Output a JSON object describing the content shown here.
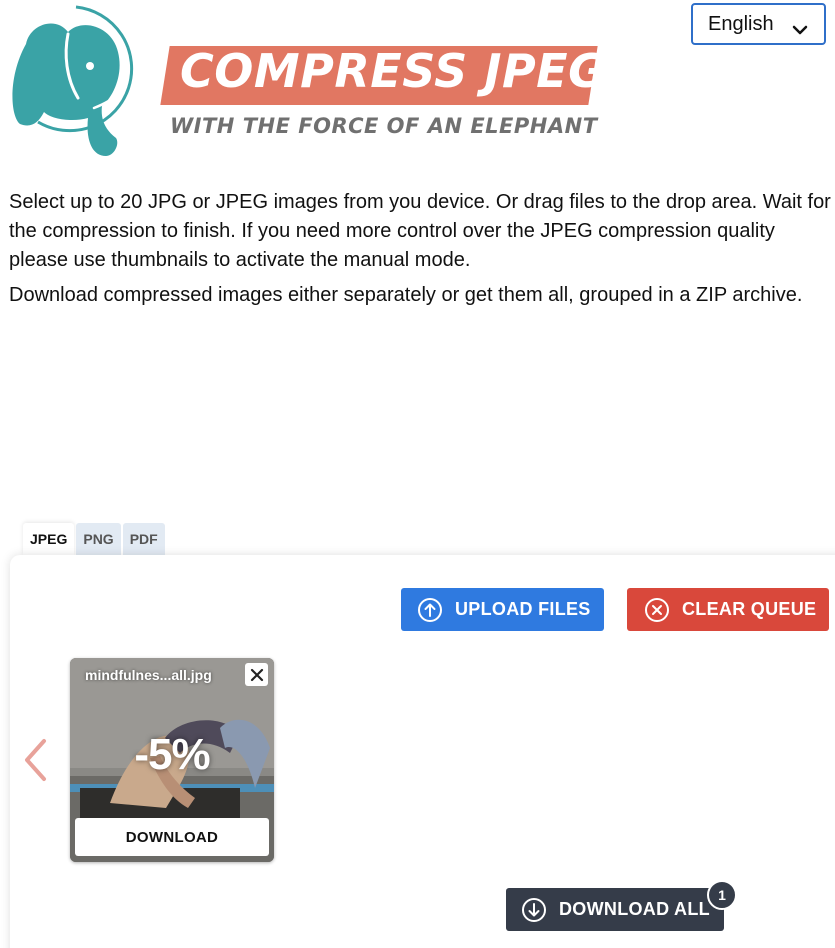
{
  "language": {
    "selected": "English"
  },
  "logo": {
    "title": "COMPRESS JPEG",
    "subtitle": "WITH THE FORCE OF AN ELEPHANT",
    "icon": "elephant-logo-icon",
    "colors": {
      "elephant": "#3aa3a6",
      "banner": "#e17762",
      "subtitle": "#707070"
    }
  },
  "intro": {
    "p1": "Select up to 20 JPG or JPEG images from you device. Or drag files to the drop area. Wait for the compression to finish. If you need more control over the JPEG compression quality please use thumbnails to activate the manual mode.",
    "p2": "Download compressed images either separately or get them all, grouped in a ZIP archive."
  },
  "tabs": [
    {
      "label": "JPEG",
      "active": true
    },
    {
      "label": "PNG",
      "active": false
    },
    {
      "label": "PDF",
      "active": false
    }
  ],
  "toolbar": {
    "upload_label": "UPLOAD FILES",
    "clear_label": "CLEAR QUEUE",
    "upload_color": "#2f7ae0",
    "clear_color": "#d9483b"
  },
  "queue": {
    "files": [
      {
        "name": "mindfulnes...all.jpg",
        "reduction": "-5%",
        "download_label": "DOWNLOAD"
      }
    ]
  },
  "download_all": {
    "label": "DOWNLOAD ALL",
    "count": "1",
    "color": "#353c49"
  }
}
